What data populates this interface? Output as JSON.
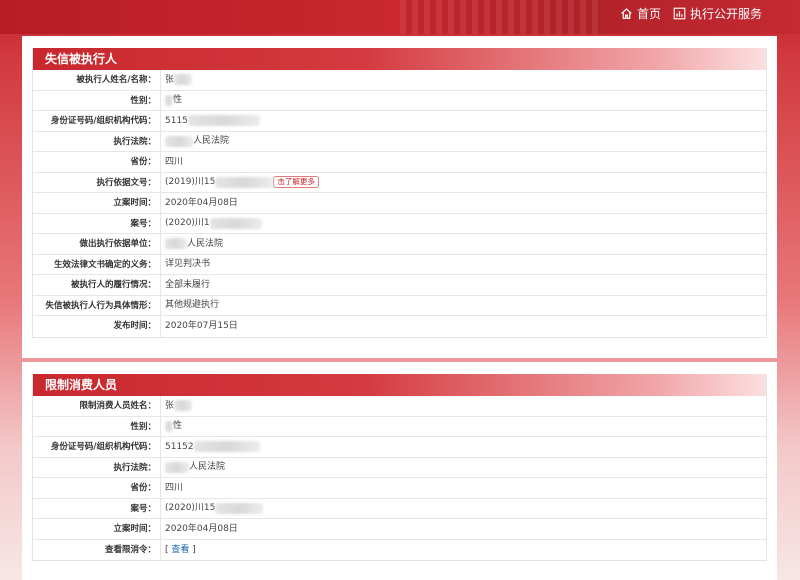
{
  "nav": {
    "home_label": "首页",
    "service_label": "执行公开服务"
  },
  "section1": {
    "title": "失信被执行人",
    "rows": [
      {
        "label": "被执行人姓名/名称：",
        "value": "张"
      },
      {
        "label": "性别：",
        "value": "性"
      },
      {
        "label": "身份证号码/组织机构代码：",
        "value": "5115"
      },
      {
        "label": "执行法院：",
        "value": "人民法院"
      },
      {
        "label": "省份：",
        "value": "四川"
      },
      {
        "label": "执行依据文号：",
        "value": "(2019)川15",
        "button": "击了解更多"
      },
      {
        "label": "立案时间：",
        "value": "2020年04月08日"
      },
      {
        "label": "案号：",
        "value": "(2020)川1"
      },
      {
        "label": "做出执行依据单位：",
        "value": "人民法院"
      },
      {
        "label": "生效法律文书确定的义务：",
        "value": "详见判决书"
      },
      {
        "label": "被执行人的履行情况：",
        "value": "全部未履行"
      },
      {
        "label": "失信被执行人行为具体情形：",
        "value": "其他规避执行"
      },
      {
        "label": "发布时间：",
        "value": "2020年07月15日"
      }
    ]
  },
  "section2": {
    "title": "限制消费人员",
    "rows": [
      {
        "label": "限制消费人员姓名：",
        "value": "张"
      },
      {
        "label": "性别：",
        "value": "性"
      },
      {
        "label": "身份证号码/组织机构代码：",
        "value": "51152"
      },
      {
        "label": "执行法院：",
        "value": "人民法院"
      },
      {
        "label": "省份：",
        "value": "四川"
      },
      {
        "label": "案号：",
        "value": "(2020)川15"
      },
      {
        "label": "立案时间：",
        "value": "2020年04月08日"
      },
      {
        "label": "查看限消令：",
        "value_prefix": "[ ",
        "link": "查看",
        "value_suffix": " ]"
      }
    ]
  }
}
